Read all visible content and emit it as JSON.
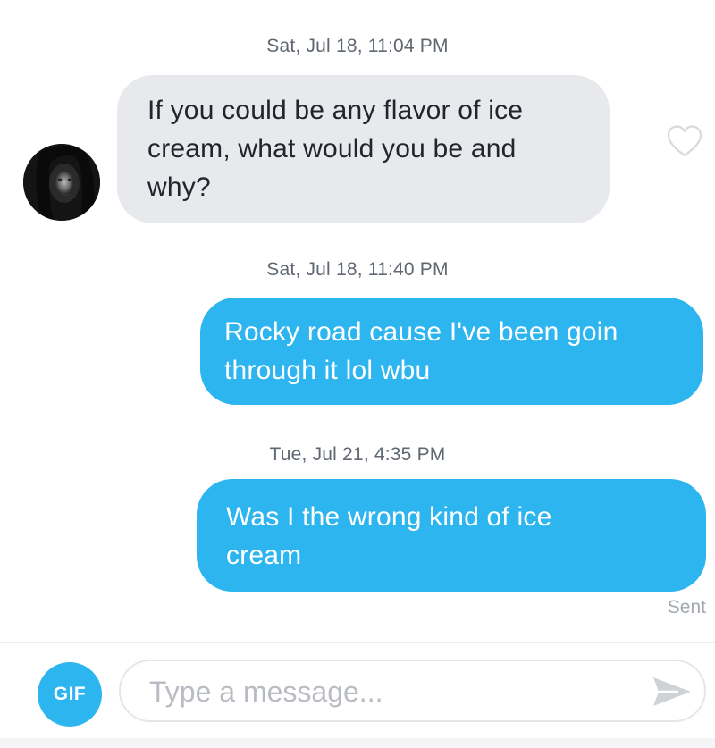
{
  "conversation": {
    "messages": [
      {
        "direction": "incoming",
        "timestamp": "Sat, Jul 18, 11:04 PM",
        "lines": [
          "If you could be any flavor of ice",
          "cream, what would you be and",
          "why?"
        ]
      },
      {
        "direction": "outgoing",
        "timestamp": "Sat, Jul 18, 11:40 PM",
        "lines": [
          "Rocky road cause I've been goin",
          "through it lol wbu"
        ]
      },
      {
        "direction": "outgoing",
        "timestamp": "Tue, Jul 21, 4:35 PM",
        "lines": [
          "Was I the wrong kind of ice",
          "cream"
        ]
      }
    ],
    "sent_status": "Sent"
  },
  "icons": {
    "avatar": "profile-photo",
    "like": "heart-outline-icon",
    "send": "send-arrow-icon"
  },
  "composer": {
    "gif_label": "GIF",
    "placeholder": "Type a message..."
  },
  "colors": {
    "accent": "#2db5f0",
    "incoming_bubble": "#e8e9ec",
    "incoming_text": "#21262e",
    "outgoing_text": "#ffffff",
    "timestamp": "#5f6770",
    "muted": "#a3a8b0"
  }
}
